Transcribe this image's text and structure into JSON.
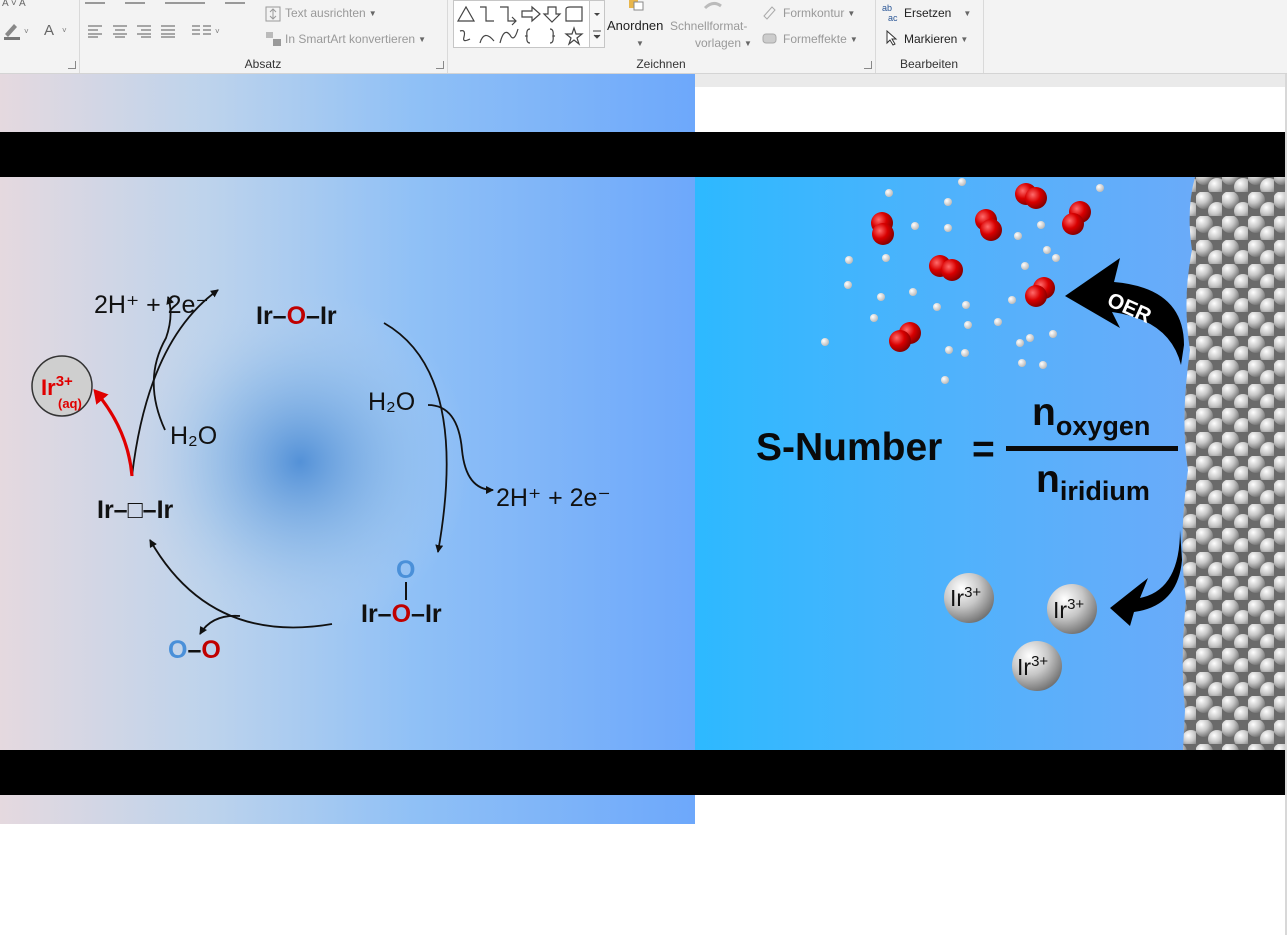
{
  "ribbon": {
    "absatz": {
      "text_align_label": "Text ausrichten",
      "smartart_label": "In SmartArt konvertieren",
      "group_label": "Absatz"
    },
    "zeichnen": {
      "arrange_label": "Anordnen",
      "quickstyles_label_1": "Schnellformat-",
      "quickstyles_label_2": "vorlagen",
      "outline_label": "Formkontur",
      "effects_label": "Formeffekte",
      "group_label": "Zeichnen"
    },
    "bearbeiten": {
      "replace_icon_text": "ab ac",
      "replace_label": "Ersetzen",
      "select_label": "Markieren",
      "group_label": "Bearbeiten"
    }
  },
  "slide": {
    "cycle": {
      "top_products": "2H⁺ +  2e⁻",
      "ir_o_ir_left": "Ir–",
      "ir_o_ir_o": "O",
      "ir_o_ir_right": "–Ir",
      "water_right": "H₂O",
      "products_right": "2H⁺ +  2e⁻",
      "peroxo_o": "O",
      "ir_o_ir_bottom_left": "Ir–",
      "ir_o_ir_bottom_o": "O",
      "ir_o_ir_bottom_right": "–Ir",
      "oxygen_o1": "O",
      "oxygen_dash": "–",
      "oxygen_o2": "O",
      "vacancy_label": "Ir–□–Ir",
      "water_left": "H₂O",
      "ir_aq_main": "Ir",
      "ir_aq_charge": "3+",
      "ir_aq_sub": "(aq)"
    },
    "formula": {
      "lhs": "S-Number",
      "equals": "=",
      "num_n": "n",
      "num_sub": "oxygen",
      "den_n": "n",
      "den_sub": "iridium"
    },
    "oer_label": "OER",
    "ions": [
      {
        "main": "Ir",
        "charge": "3+"
      },
      {
        "main": "Ir",
        "charge": "3+"
      },
      {
        "main": "Ir",
        "charge": "3+"
      }
    ]
  },
  "colors": {
    "accent_red": "#c00000",
    "accent_blue": "#4a90d9",
    "arrow_red": "#e00000"
  }
}
